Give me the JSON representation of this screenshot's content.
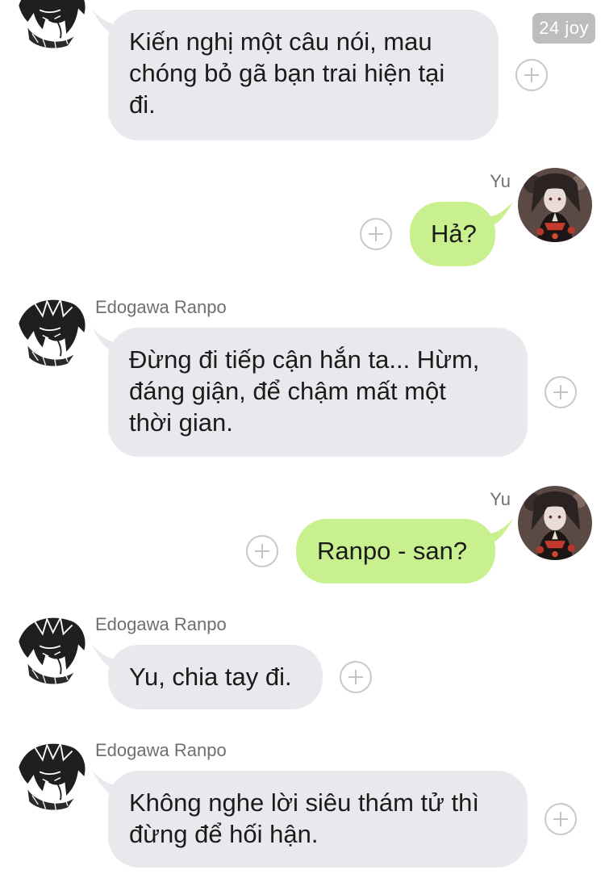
{
  "watermark": "24 joy",
  "contacts": {
    "ranpo": {
      "name": "Edogawa Ranpo",
      "avatar_icon": "ranpo-avatar-icon"
    },
    "yu": {
      "name": "Yu",
      "avatar_icon": "yu-avatar-icon"
    }
  },
  "colors": {
    "incoming_bubble": "#e8e9ed",
    "outgoing_bubble": "#c9f08f",
    "name_text": "#6f6f6f",
    "plus_icon": "#c8c8c8"
  },
  "messages": [
    {
      "sender": "Edogawa Ranpo",
      "direction": "incoming",
      "lines": [
        "Kiến nghị một câu nói, mau",
        "chóng bỏ gã bạn trai hiện tại",
        "đi."
      ]
    },
    {
      "sender": "Yu",
      "direction": "outgoing",
      "lines": [
        "Hả?"
      ]
    },
    {
      "sender": "Edogawa Ranpo",
      "direction": "incoming",
      "lines": [
        "Đừng đi tiếp cận hắn ta... Hừm,",
        "đáng giận, để chậm mất một",
        "thời gian."
      ]
    },
    {
      "sender": "Yu",
      "direction": "outgoing",
      "lines": [
        "Ranpo - san?"
      ]
    },
    {
      "sender": "Edogawa Ranpo",
      "direction": "incoming",
      "lines": [
        "Yu, chia tay đi."
      ]
    },
    {
      "sender": "Edogawa Ranpo",
      "direction": "incoming",
      "lines": [
        "Không nghe lời siêu thám tử thì",
        "đừng để hối hận."
      ]
    }
  ]
}
